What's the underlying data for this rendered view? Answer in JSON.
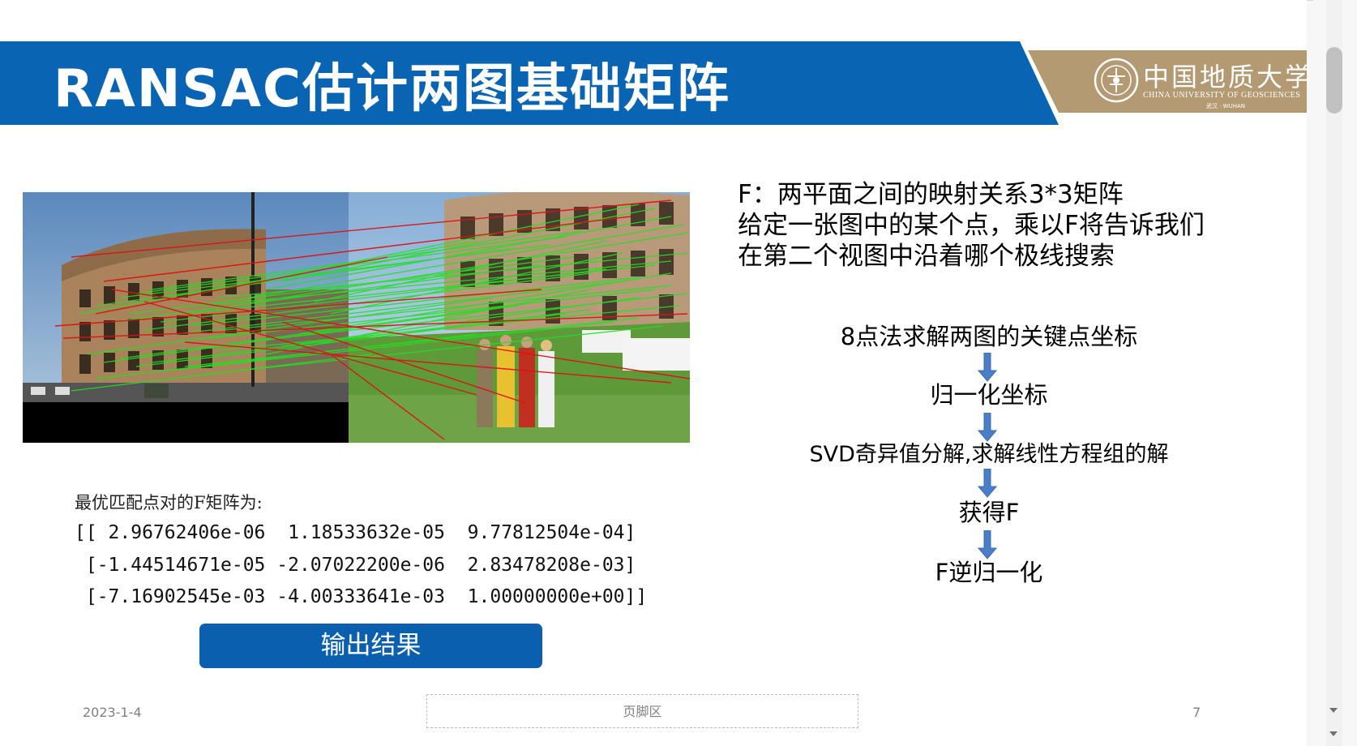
{
  "slide": {
    "title": "RANSAC估计两图基础矩阵",
    "logo": {
      "name_cn": "中国地质大学",
      "name_en": "CHINA UNIVERSITY OF GEOSCIENCES",
      "sub": "武汉 · WUHAN"
    },
    "description": [
      "F：两平面之间的映射关系3*3矩阵",
      "给定一张图中的某个点，乘以F将告诉我们",
      "在第二个视图中沿着哪个极线搜索"
    ],
    "flow_steps": [
      "8点法求解两图的关键点坐标",
      "归一化坐标",
      "SVD奇异值分解,求解线性方程组的解",
      "获得F",
      "F逆归一化"
    ],
    "matrix": {
      "caption": "最优匹配点对的F矩阵为:",
      "rows": [
        "[[ 2.96762406e-06  1.18533632e-05  9.77812504e-04]",
        " [-1.44514671e-05 -2.07022200e-06  2.83478208e-03]",
        " [-7.16902545e-03 -4.00333641e-03  1.00000000e+00]]"
      ]
    },
    "button_label": "输出结果",
    "footer": {
      "date": "2023-1-4",
      "center": "页脚区",
      "page_number": "7"
    }
  },
  "colors": {
    "banner_blue": "#0a64b4",
    "logo_gold": "#b49a72",
    "button_blue": "#0a5faf",
    "match_green": "#22e022",
    "outlier_red": "#e01010",
    "arrow_blue": "#4a7fc8"
  }
}
